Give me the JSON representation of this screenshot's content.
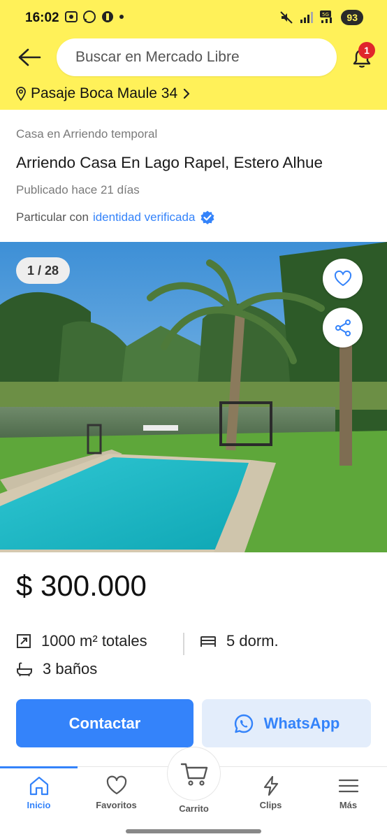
{
  "status_bar": {
    "time": "16:02",
    "battery": "93"
  },
  "header": {
    "search_placeholder": "Buscar en Mercado Libre",
    "notification_count": "1",
    "location": "Pasaje Boca Maule 34"
  },
  "listing": {
    "category": "Casa en Arriendo temporal",
    "title": "Arriendo Casa En Lago Rapel, Estero Alhue",
    "published": "Publicado hace 21 días",
    "seller_prefix": "Particular con",
    "seller_link": "identidad verificada",
    "photo_counter": "1 / 28",
    "price": "$ 300.000",
    "area": "1000 m² totales",
    "bedrooms": "5 dorm.",
    "bathrooms": "3 baños"
  },
  "actions": {
    "contact": "Contactar",
    "whatsapp": "WhatsApp"
  },
  "tabbar": {
    "items": [
      {
        "label": "Inicio",
        "icon": "home-icon",
        "active": true
      },
      {
        "label": "Favoritos",
        "icon": "heart-icon"
      },
      {
        "label": "Carrito",
        "icon": "cart-icon"
      },
      {
        "label": "Clips",
        "icon": "lightning-icon"
      },
      {
        "label": "Más",
        "icon": "menu-icon"
      }
    ]
  },
  "colors": {
    "brand_yellow": "#fff159",
    "accent_blue": "#3483fa",
    "badge_red": "#e0262b"
  }
}
